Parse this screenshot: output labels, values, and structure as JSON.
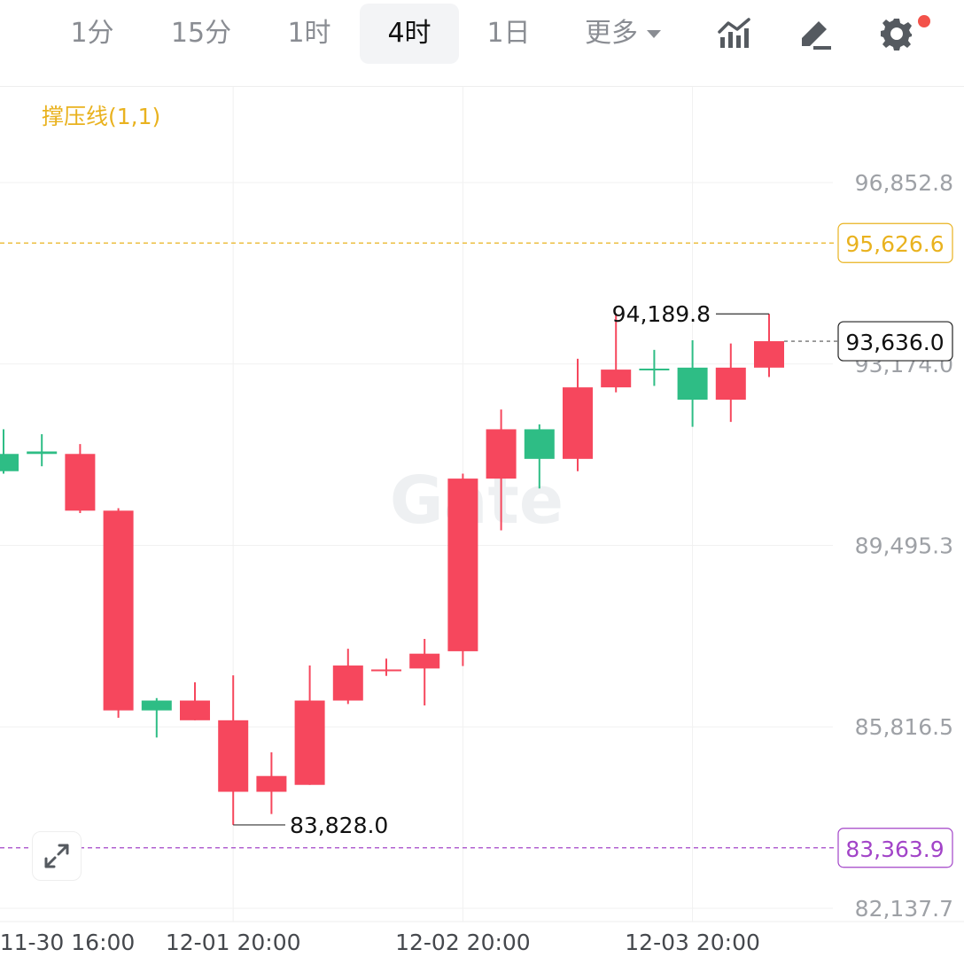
{
  "toolbar": {
    "timeframes": [
      "1分",
      "15分",
      "1时",
      "4时",
      "1日"
    ],
    "active": "4时",
    "more_label": "更多"
  },
  "indicator_label": "撑压线(1,1)",
  "watermark": "Gate",
  "colors": {
    "up": "#f6475d",
    "down": "#2ebd85",
    "resistance": "#e9b21f",
    "support": "#a244c8",
    "notification_dot": "#f3524a"
  },
  "chart_data": {
    "type": "candlestick",
    "y_ticks": [
      96852.8,
      93174.0,
      89495.3,
      85816.5,
      82137.7
    ],
    "y_tick_labels": [
      "96,852.8",
      "93,174.0",
      "89,495.3",
      "85,816.5",
      "82,137.7"
    ],
    "x_ticks": [
      {
        "label": "11-30 16:00",
        "index": -0.5
      },
      {
        "label": "12-01 20:00",
        "index": 6
      },
      {
        "label": "12-02 20:00",
        "index": 12
      },
      {
        "label": "12-03 20:00",
        "index": 18
      }
    ],
    "candles": [
      {
        "open": 91350,
        "high": 91850,
        "low": 90950,
        "close": 91000
      },
      {
        "open": 91400,
        "high": 91750,
        "low": 91100,
        "close": 91350
      },
      {
        "open": 90200,
        "high": 91550,
        "low": 90150,
        "close": 91350
      },
      {
        "open": 86150,
        "high": 90250,
        "low": 86000,
        "close": 90200
      },
      {
        "open": 86350,
        "high": 86400,
        "low": 85600,
        "close": 86150
      },
      {
        "open": 85950,
        "high": 86720,
        "low": 85950,
        "close": 86350
      },
      {
        "open": 84500,
        "high": 86860,
        "low": 83828,
        "close": 85950
      },
      {
        "open": 84500,
        "high": 85300,
        "low": 84050,
        "close": 84820
      },
      {
        "open": 84640,
        "high": 87060,
        "low": 84640,
        "close": 86350
      },
      {
        "open": 86350,
        "high": 87400,
        "low": 86280,
        "close": 87060
      },
      {
        "open": 86980,
        "high": 87200,
        "low": 86850,
        "close": 86980
      },
      {
        "open": 87000,
        "high": 87600,
        "low": 86250,
        "close": 87300
      },
      {
        "open": 87350,
        "high": 90950,
        "low": 87050,
        "close": 90850
      },
      {
        "open": 90850,
        "high": 92250,
        "low": 89800,
        "close": 91850
      },
      {
        "open": 91850,
        "high": 91950,
        "low": 90650,
        "close": 91250
      },
      {
        "open": 91250,
        "high": 93280,
        "low": 91000,
        "close": 92700
      },
      {
        "open": 92700,
        "high": 94190,
        "low": 92600,
        "close": 93060
      },
      {
        "open": 93080,
        "high": 93460,
        "low": 92730,
        "close": 93070
      },
      {
        "open": 93100,
        "high": 93655,
        "low": 91900,
        "close": 92450
      },
      {
        "open": 92450,
        "high": 93590,
        "low": 92000,
        "close": 93100
      },
      {
        "open": 93100,
        "high": 94189.8,
        "low": 92910,
        "close": 93636
      }
    ],
    "annotations": [
      {
        "label": "94,189.8",
        "value": 94189.8,
        "index": 20,
        "kind": "high"
      },
      {
        "label": "83,828.0",
        "value": 83828.0,
        "index": 6,
        "kind": "low"
      }
    ],
    "last_price": {
      "value": 93636.0,
      "label": "93,636.0"
    },
    "resistance": {
      "value": 95626.6,
      "label": "95,626.6"
    },
    "support": {
      "value": 83363.9,
      "label": "83,363.9"
    }
  }
}
